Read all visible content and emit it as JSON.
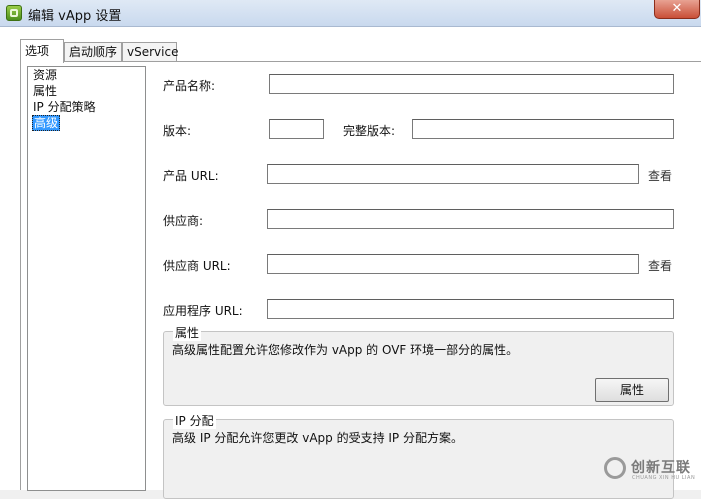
{
  "window": {
    "title": "编辑 vApp 设置",
    "close_label": "✕"
  },
  "tabs": [
    {
      "label": "选项",
      "active": true
    },
    {
      "label": "启动顺序",
      "active": false
    },
    {
      "label": "vService",
      "active": false
    }
  ],
  "nav": {
    "items": [
      {
        "label": "资源",
        "selected": false
      },
      {
        "label": "属性",
        "selected": false
      },
      {
        "label": "IP 分配策略",
        "selected": false
      },
      {
        "label": "高级",
        "selected": true
      }
    ]
  },
  "form": {
    "product_name": {
      "label": "产品名称:",
      "value": ""
    },
    "version": {
      "label": "版本:",
      "value": ""
    },
    "full_version": {
      "label": "完整版本:",
      "value": ""
    },
    "product_url": {
      "label": "产品 URL:",
      "value": "",
      "view_label": "查看"
    },
    "vendor": {
      "label": "供应商:",
      "value": ""
    },
    "vendor_url": {
      "label": "供应商 URL:",
      "value": "",
      "view_label": "查看"
    },
    "app_url": {
      "label": "应用程序 URL:",
      "value": ""
    }
  },
  "properties_group": {
    "title": "属性",
    "description": "高级属性配置允许您修改作为 vApp 的 OVF 环境一部分的属性。",
    "button_label": "属性"
  },
  "ip_group": {
    "title": "IP 分配",
    "description": "高级 IP 分配允许您更改 vApp 的受支持 IP 分配方案。"
  },
  "watermark": {
    "text": "创新互联",
    "subtext": "CHUANG XIN HU LIAN"
  }
}
